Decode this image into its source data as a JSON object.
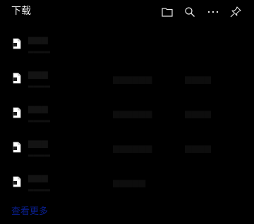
{
  "header": {
    "title": "下载",
    "buttons": [
      {
        "name": "open-folder-button",
        "icon": "folder-icon"
      },
      {
        "name": "search-button",
        "icon": "search-icon"
      },
      {
        "name": "more-options-button",
        "icon": "ellipsis-icon"
      },
      {
        "name": "pin-button",
        "icon": "pin-icon"
      }
    ]
  },
  "downloads": [
    {
      "icon": "file-icon"
    },
    {
      "icon": "file-icon"
    },
    {
      "icon": "file-icon"
    },
    {
      "icon": "file-icon"
    },
    {
      "icon": "file-icon"
    }
  ],
  "footer": {
    "see_more": "查看更多"
  },
  "colors": {
    "background": "#000000",
    "title": "#f2f2f2",
    "icon": "#e6e6e6",
    "link": "#0a1f8f"
  }
}
